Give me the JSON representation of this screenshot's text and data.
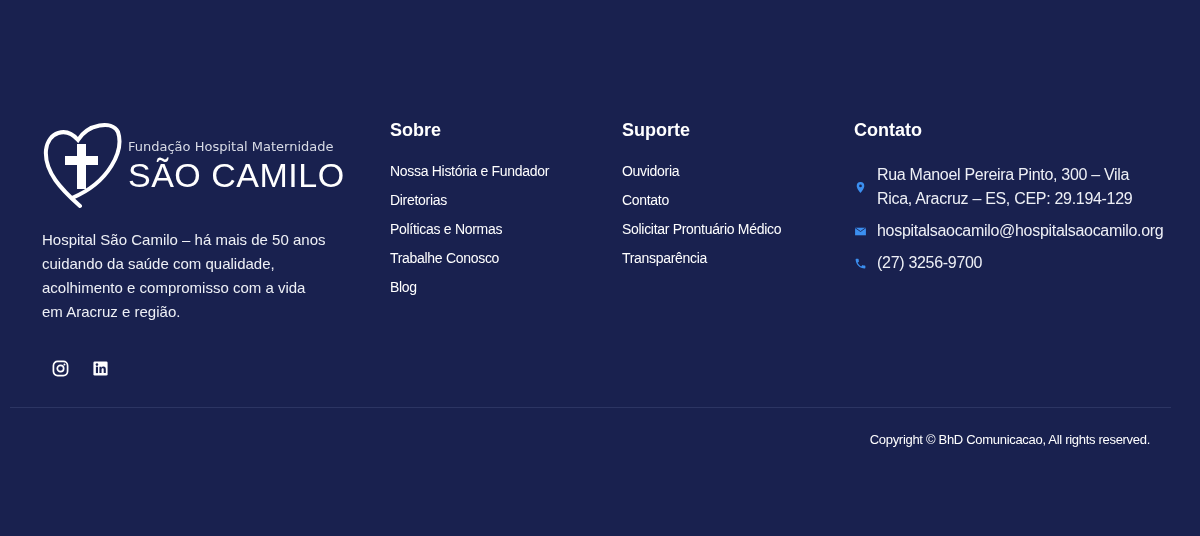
{
  "brand": {
    "logo_subtitle": "Fundação Hospital Maternidade",
    "logo_title": "SÃO CAMILO",
    "description": "Hospital São Camilo – há mais de 50 anos cuidando da saúde com qualidade, acolhimento e compromisso com a vida em Aracruz e região.",
    "social": [
      {
        "kind": "instagram"
      },
      {
        "kind": "linkedin"
      }
    ]
  },
  "columns": [
    {
      "title": "Sobre",
      "links": [
        "Nossa História e Fundador",
        "Diretorias",
        "Políticas e Normas",
        "Trabalhe Conosco",
        "Blog"
      ]
    },
    {
      "title": "Suporte",
      "links": [
        "Ouvidoria",
        "Contato",
        "Solicitar Prontuário Médico",
        "Transparência"
      ]
    }
  ],
  "contact": {
    "title": "Contato",
    "items": [
      {
        "kind": "address",
        "text": "Rua Manoel Pereira Pinto, 300 – Vila Rica, Aracruz – ES, CEP: 29.194-129"
      },
      {
        "kind": "email",
        "text": "hospitalsaocamilo@hospitalsaocamilo.org"
      },
      {
        "kind": "phone",
        "text": "(27) 3256-9700"
      }
    ]
  },
  "copyright": "Copyright © BhD Comunicacao, All rights reserved."
}
